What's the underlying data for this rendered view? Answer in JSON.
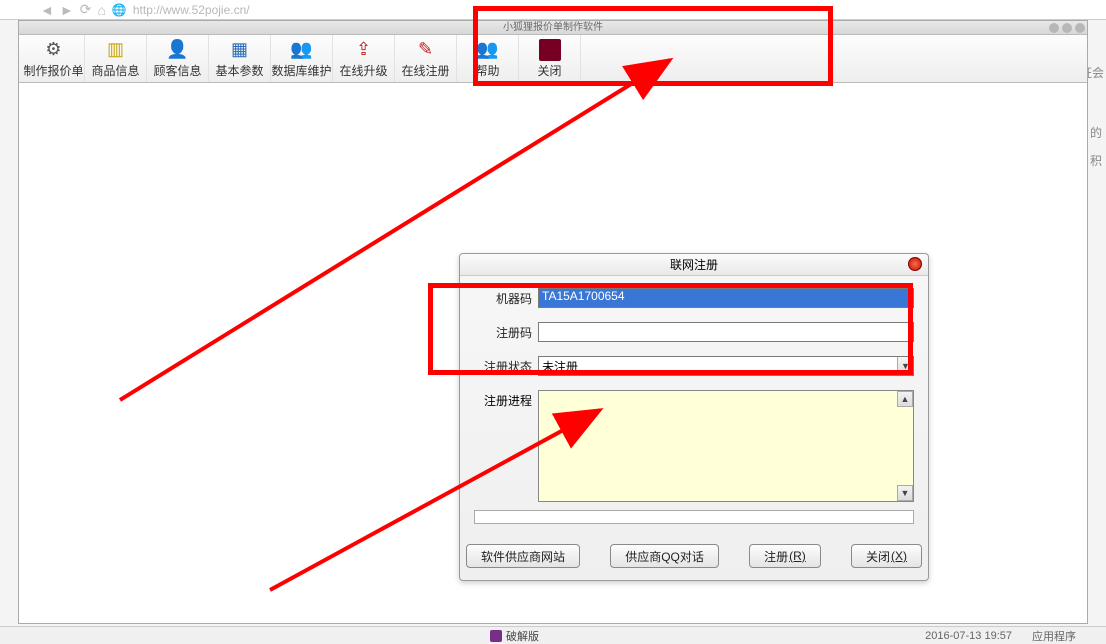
{
  "browser": {
    "url": "http://www.52pojie.cn/"
  },
  "window": {
    "title": "小狐狸报价单制作软件"
  },
  "toolbar": {
    "items": [
      {
        "icon": "gear-icon",
        "label": "制作报价单"
      },
      {
        "icon": "package-icon",
        "label": "商品信息"
      },
      {
        "icon": "person-icon",
        "label": "顾客信息"
      },
      {
        "icon": "grid-icon",
        "label": "基本参数"
      },
      {
        "icon": "db-person-icon",
        "label": "数据库维护"
      },
      {
        "icon": "upgrade-icon",
        "label": "在线升级"
      },
      {
        "icon": "register-icon",
        "label": "在线注册"
      },
      {
        "icon": "help-icon",
        "label": "帮助"
      },
      {
        "icon": "close-icon",
        "label": "关闭"
      }
    ]
  },
  "dialog": {
    "title": "联网注册",
    "fields": {
      "machine_code_label": "机器码",
      "machine_code_value": "TA15A1700654",
      "reg_code_label": "注册码",
      "reg_code_value": "",
      "reg_status_label": "注册状态",
      "reg_status_value": "未注册",
      "progress_label": "注册进程"
    },
    "buttons": {
      "vendor_site": "软件供应商网站",
      "vendor_qq": "供应商QQ对话",
      "register": "注册",
      "register_hotkey": "(R)",
      "close": "关闭",
      "close_hotkey": "(X)"
    }
  },
  "statusbar": {
    "left_text": "破解版",
    "datetime": "2016-07-13 19:57",
    "type_text": "应用程序"
  },
  "side_text": {
    "right1": "证会",
    "right2": "的",
    "right3": "积"
  }
}
